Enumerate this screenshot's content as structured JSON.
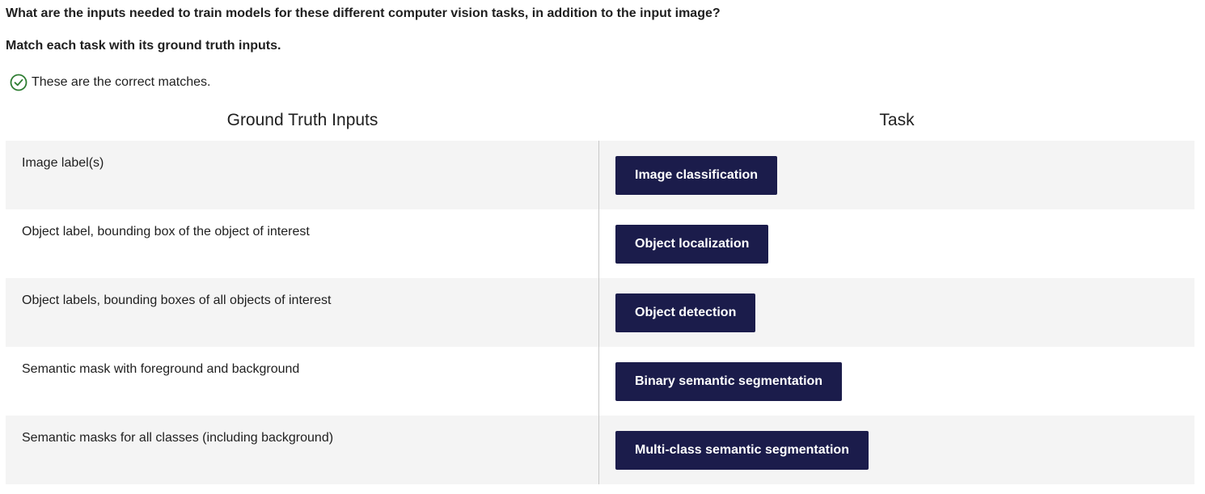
{
  "question": "What are the inputs needed to train models for these different computer vision tasks, in addition to the input image?",
  "instruction": "Match each task with its ground truth inputs.",
  "feedback": {
    "icon": "check-circle-icon",
    "text": "These are the correct matches.",
    "color": "#2e7d32"
  },
  "columns": {
    "left": "Ground Truth Inputs",
    "right": "Task"
  },
  "rows": [
    {
      "input": "Image label(s)",
      "task": "Image classification"
    },
    {
      "input": "Object label, bounding box of the object of interest",
      "task": "Object localization"
    },
    {
      "input": "Object labels, bounding boxes of all objects of interest",
      "task": "Object detection"
    },
    {
      "input": "Semantic mask with foreground and background",
      "task": "Binary semantic segmentation"
    },
    {
      "input": "Semantic masks for all classes (including background)",
      "task": "Multi-class semantic segmentation"
    }
  ],
  "colors": {
    "button_bg": "#1b1c4b",
    "row_alt_bg": "#f4f4f4"
  }
}
